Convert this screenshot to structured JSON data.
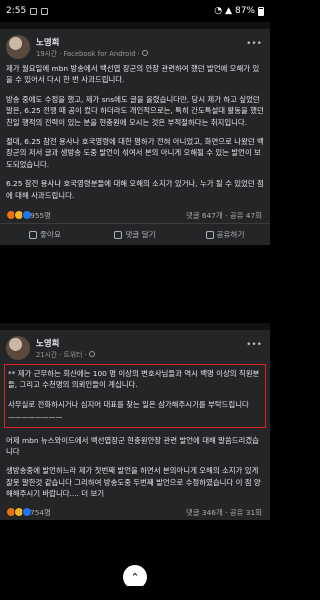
{
  "status_bar": {
    "time": "2:55",
    "battery": "87%"
  },
  "top_strip": {
    "left": "좋아요",
    "right": "공유하기"
  },
  "post1": {
    "author": "노영희",
    "meta": "19시간 · Facebook for Android ·",
    "paragraphs": [
      "제가 월요일에 mbn 방송에서 백선엽 장군의 안장 관련하여 했던 발언에 오해가 있을 수 있어서 다시 한 번 사과드립니다.",
      "방송 중에도 수정을 했고, 제가 sns에도 글을 올렸습니다만, 당시 제가 하고 싶었던 말은, 6.25 전쟁 때 공이 컸다 하더라도 개인적으로는, 특히 간도특설대 활동을 했던 친일 행적의 전력이 있는 분을 현충원에 모시는 것은 부적절하다는 취지입니다.",
      "절대, 6.25 참전 용사나 호국영령에 대한 폄하가 전혀 아니었고, 화면으로 나왔던 백 장군의 저서 글과 생방송 도중 발언이 섞여서 본의 아니게 오해될 수 있는 발언이 보도되었습니다.",
      "6.25 참전 용사나 호국영령분들에 대해 오해의 소지가 있거나, 누가 될 수 있었던 점에 대해 사과드립니다."
    ],
    "reactions_count": "955명",
    "stats": "댓글 647개 · 공유 47회"
  },
  "actions": {
    "like": "좋아요",
    "comment": "댓글 달기",
    "share": "공유하기"
  },
  "post2": {
    "author": "노영희",
    "meta": "21시간 · 트위터 ·",
    "highlight_paragraphs": [
      "** 제가 근무하는 회산에는 100 명 이상의 변호사님들과 역시 백명 이상의 직원분들, 그리고 수천명의 의뢰인들이 계십니다.",
      "사무실로 전화하시거나 심지어 대표를 찾는 일은 삼가해주시기를 부탁드립니다",
      "ㅡㅡㅡㅡㅡㅡㅡㅡ"
    ],
    "paragraphs": [
      "어제 mbn 뉴스와이드에서 백선엽장군 현충원안장 관련 발언에 대해 말씀드리겠습니다",
      "생방송중에 발언하느라 제가 첫번째 발언을 하면서 본의아니게 오해의 소지가 있게 잘못 말한것 같습니다 그리하여 방송도중 두번째 발언으로 수정하였습니다 이 점 양해해주시기 바랍니다.... 더 보기"
    ],
    "reactions_count": "754명",
    "stats": "댓글 346개 · 공유 31회"
  },
  "colors": {
    "background": "#000000",
    "card": "#242526",
    "text": "#e4e6eb",
    "highlight_border": "#e02020"
  },
  "icons": [
    "globe-icon",
    "more-icon",
    "like-icon",
    "comment-icon",
    "share-icon",
    "scroll-top-icon"
  ]
}
